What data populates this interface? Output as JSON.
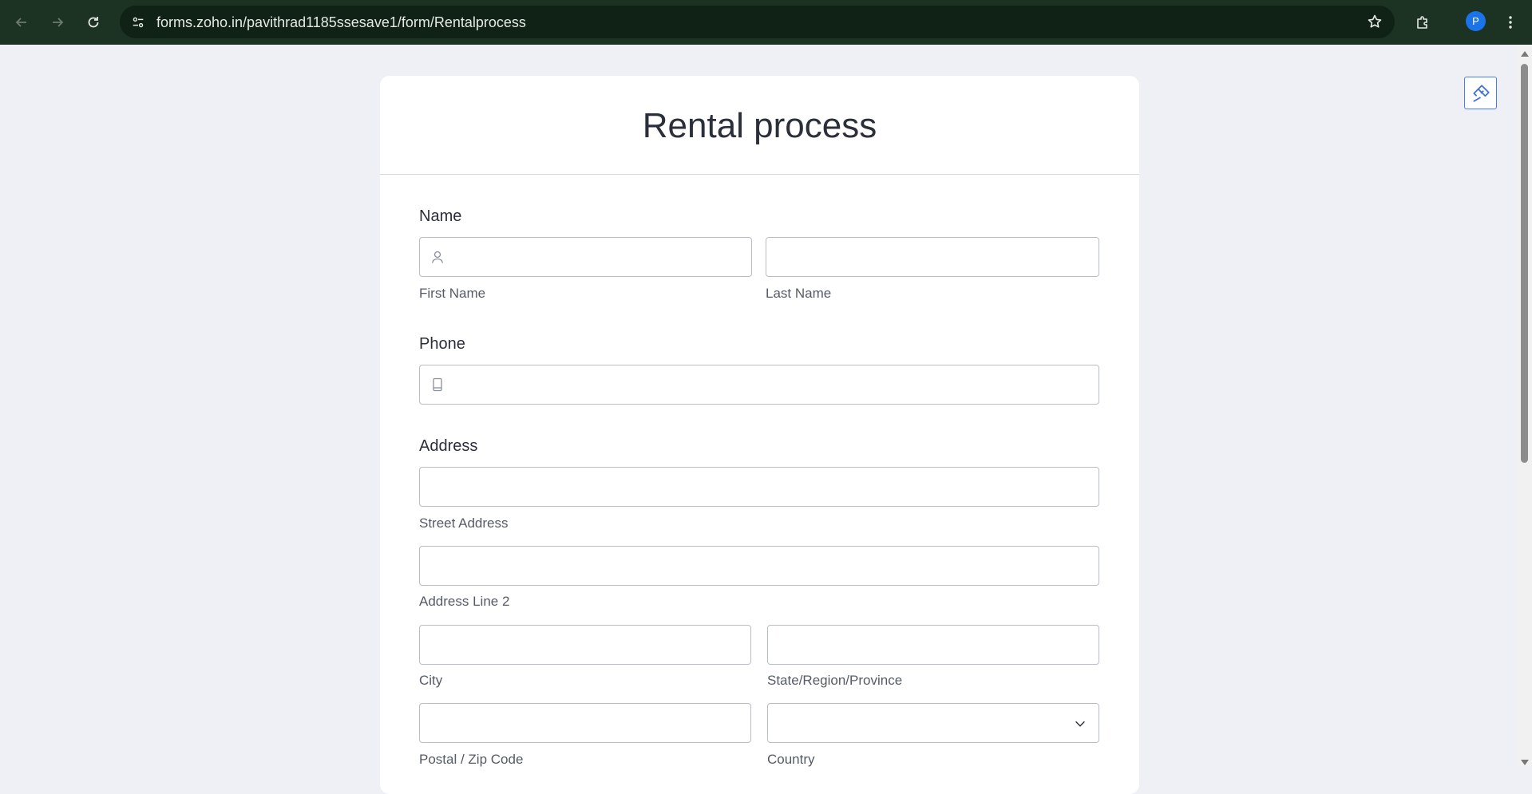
{
  "browser": {
    "url": "forms.zoho.in/pavithrad1185ssesave1/form/Rentalprocess",
    "profile_initial": "P"
  },
  "form": {
    "title": "Rental process",
    "name": {
      "label": "Name",
      "first_name": "First Name",
      "last_name": "Last Name"
    },
    "phone": {
      "label": "Phone"
    },
    "address": {
      "label": "Address",
      "street": "Street Address",
      "line2": "Address Line 2",
      "city": "City",
      "state": "State/Region/Province",
      "postal": "Postal / Zip Code",
      "country": "Country"
    }
  },
  "colors": {
    "chrome": "#1c3323",
    "accent": "#1a73e8",
    "page_bg": "#eef0f5"
  }
}
